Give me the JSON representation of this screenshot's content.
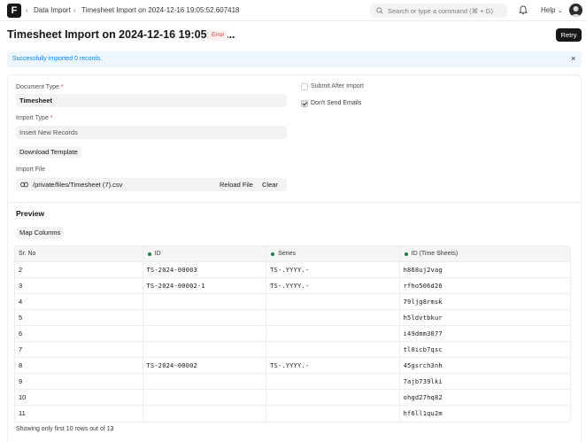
{
  "navbar": {
    "logo": "F",
    "breadcrumbs": [
      "Data Import",
      "Timesheet Import on 2024-12-16 19:05:52.607418"
    ],
    "search_placeholder": "Search or type a command (⌘ + G)",
    "help_label": "Help"
  },
  "page": {
    "title": "Timesheet Import on 2024-12-16 19:05:52....",
    "status_badge": "Error",
    "retry_label": "Retry"
  },
  "alert": {
    "message": "Successfully imported 0 records."
  },
  "form": {
    "document_type_label": "Document Type",
    "document_type_value": "Timesheet",
    "import_type_label": "Import Type",
    "import_type_value": "Insert New Records",
    "download_template_label": "Download Template",
    "import_file_label": "Import File",
    "import_file_value": "/private/files/Timesheet (7).csv",
    "reload_file_label": "Reload File",
    "clear_label": "Clear",
    "submit_after_import_label": "Submit After Import",
    "submit_after_import_checked": false,
    "dont_send_emails_label": "Don't Send Emails",
    "dont_send_emails_checked": true
  },
  "preview": {
    "heading": "Preview",
    "map_columns_label": "Map Columns",
    "columns": [
      "Sr. No",
      "ID",
      "Series",
      "ID (Time Sheets)"
    ],
    "rows": [
      [
        "2",
        "TS-2024-00003",
        "TS-.YYYY.-",
        "h868uj2vag"
      ],
      [
        "3",
        "TS-2024-00002-1",
        "TS-.YYYY.-",
        "rfho506d26"
      ],
      [
        "4",
        "",
        "",
        "79ljg8rmsk"
      ],
      [
        "5",
        "",
        "",
        "h5ldvtbkur"
      ],
      [
        "6",
        "",
        "",
        "i49dmm3077"
      ],
      [
        "7",
        "",
        "",
        "tl0icb7qsc"
      ],
      [
        "8",
        "TS-2024-00002",
        "TS-.YYYY.-",
        "45gsrch3nh"
      ],
      [
        "9",
        "",
        "",
        "7ajb739lki"
      ],
      [
        "10",
        "",
        "",
        "ohgd27hq82"
      ],
      [
        "11",
        "",
        "",
        "hf6ll1qu2m"
      ]
    ],
    "footer_note": "Showing only first 10 rows out of 13"
  }
}
